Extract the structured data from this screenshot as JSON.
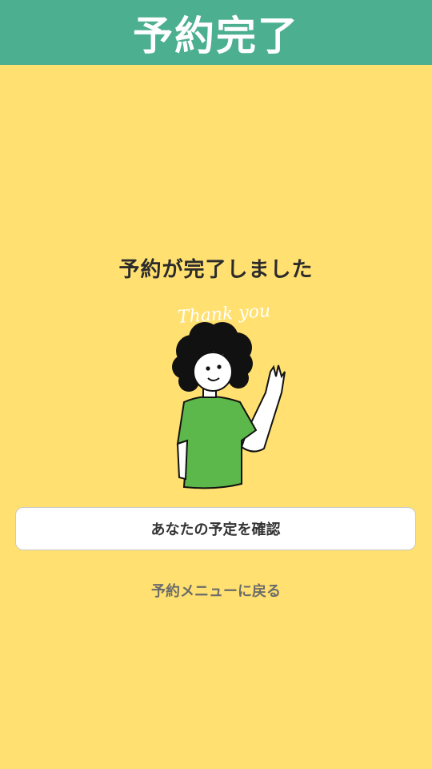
{
  "header": {
    "title": "予約完了"
  },
  "main": {
    "message": "予約が完了しました",
    "illustration_text": "Thank you",
    "confirm_button_label": "あなたの予定を確認",
    "back_link_label": "予約メニューに戻る"
  },
  "colors": {
    "header_bg": "#4caf8f",
    "page_bg": "#ffe070",
    "shirt": "#5cb84a"
  }
}
